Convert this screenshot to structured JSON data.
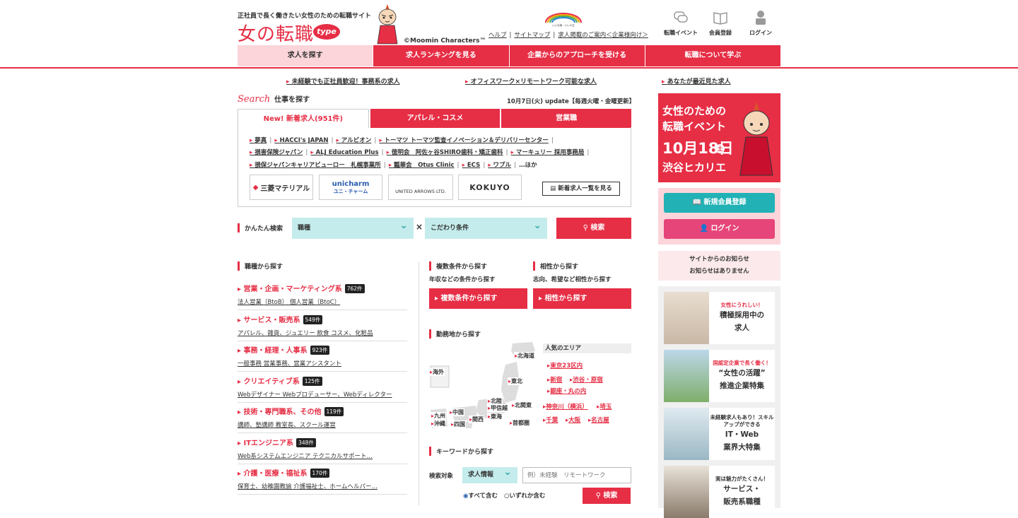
{
  "header": {
    "tagline": "正社員で長く働きたい女性のための転職サイト",
    "logo_text": "女の転職",
    "logo_badge": "type",
    "copyright": "©Moomin Characters™",
    "rainbow_caption": "いい仕事・いい人生",
    "top_links": [
      "ヘルプ",
      "サイトマップ",
      "求人掲載のご案内＜企業様向け＞"
    ],
    "icons": [
      {
        "label": "転職イベント",
        "icon": "chat-icon"
      },
      {
        "label": "会員登録",
        "icon": "book-icon"
      },
      {
        "label": "ログイン",
        "icon": "person-icon"
      }
    ],
    "nav": [
      "求人を探す",
      "求人ランキングを見る",
      "企業からのアプローチを受ける",
      "転職について学ぶ"
    ],
    "sub_links": [
      "未経験でも正社員歓迎！事務系の求人",
      "オフィスワーク×リモートワーク可能な求人",
      "あなたが最近見た求人"
    ]
  },
  "search": {
    "title_script": "Search",
    "title": "仕事を探す",
    "update": "10月7日(火) update【毎週火曜・金曜更新】",
    "tabs": [
      "New! 新着求人(951件)",
      "アパレル・コスメ",
      "営業職"
    ],
    "company_rows": [
      [
        "夢真",
        "HACCI's JAPAN",
        "アルビオン",
        "トーマツ トーマツ監査イノベーション＆デリバリーセンター"
      ],
      [
        "損害保険ジャパン",
        "ALJ Education Plus",
        "徳明会　阿佐ヶ谷SHIRO歯科・矯正歯科",
        "マーキュリー 採用事務局"
      ],
      [
        "損保ジャパンキャリアビューロー　札幌事業所",
        "瓢華会　Otus Clinic",
        "ECS",
        "ワプル"
      ]
    ],
    "more": "…ほか",
    "logos": [
      "三菱マテリアル",
      "unicharm",
      "ユニ・チャーム",
      "UNITED ARROWS LTD.",
      "KOKUYO"
    ],
    "list_button": "新着求人一覧を見る"
  },
  "easy": {
    "label": "かんたん検索",
    "select1": "職種",
    "times": "×",
    "select2": "こだわり条件",
    "button": "検索"
  },
  "categories": {
    "title": "職種から探す",
    "items": [
      {
        "name": "営業・企画・マーケティング系",
        "count": "762件",
        "sub": "法人営業（BtoB） 個人営業（BtoC）"
      },
      {
        "name": "サービス・販売系",
        "count": "549件",
        "sub": "アパレル、雑貨、ジュエリー 飲食 コスメ、化粧品"
      },
      {
        "name": "事務・経理・人事系",
        "count": "923件",
        "sub": "一般事務 営業事務、営業アシスタント"
      },
      {
        "name": "クリエイティブ系",
        "count": "125件",
        "sub": "Webデザイナー Webプロデューサー、Webディレクター"
      },
      {
        "name": "技術・専門職系、その他",
        "count": "119件",
        "sub": "講師、塾講師 教室長、スクール運営"
      },
      {
        "name": "ITエンジニア系",
        "count": "348件",
        "sub": "Web系システムエンジニア テクニカルサポート…"
      },
      {
        "name": "介護・医療・福祉系",
        "count": "170件",
        "sub": "保育士、幼稚園教諭 介護福祉士、ホームヘルパー…"
      }
    ]
  },
  "multi": {
    "title": "複数条件から探す",
    "desc": "年収などの条件から探す",
    "button": "複数条件から探す"
  },
  "compat": {
    "title": "相性から探す",
    "desc": "志向、希望など相性から探す",
    "button": "相性から探す"
  },
  "location": {
    "title": "勤務地から探す",
    "prefs": [
      "北海道",
      "東北",
      "海外",
      "北陸",
      "甲信越",
      "北関東",
      "首都圏",
      "東海",
      "関西",
      "中国",
      "四国",
      "九州",
      "沖縄"
    ],
    "popular_title": "人気のエリア",
    "areas": [
      "東京23区内",
      "新宿",
      "渋谷・原宿",
      "銀座・丸の内",
      "神奈川（横浜）",
      "埼玉",
      "千葉",
      "大阪",
      "名古屋"
    ]
  },
  "keyword": {
    "title": "キーワードから探す",
    "target_label": "検索対象",
    "target": "求人情報",
    "placeholder": "例）未経験　リモートワーク",
    "radio1": "すべて含む",
    "radio2": "いずれか含む",
    "button": "検索"
  },
  "side": {
    "event_l1": "女性のための",
    "event_l2": "転職イベント",
    "event_date": "10月18日",
    "event_day": "土",
    "event_place": "渋谷ヒカリエ",
    "register": "新規会員登録",
    "login": "ログイン",
    "notice_title": "サイトからのお知らせ",
    "notice_body": "お知らせはありません",
    "features": [
      {
        "small": "女性にうれしい！",
        "l1": "積極採用中の",
        "l2": "求人"
      },
      {
        "small": "国認定企業で長く働く！",
        "l1": "“女性の活躍”",
        "l2": "推進企業特集"
      },
      {
        "small": "未経験求人もあり！スキルアップができる",
        "l1": "IT・Web",
        "l2": "業界大特集"
      },
      {
        "small": "実は魅力がたくさん！",
        "l1": "サービス・",
        "l2": "販売系職種"
      }
    ]
  },
  "colors": {
    "accent": "#e62e45",
    "teal": "#22b1b5",
    "pink": "#fbd5da"
  }
}
